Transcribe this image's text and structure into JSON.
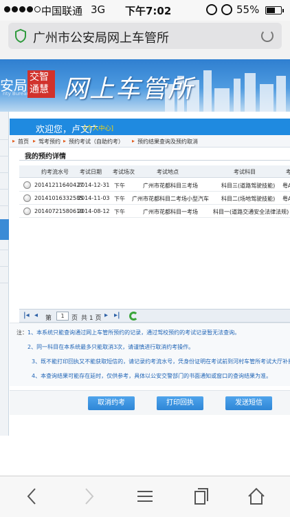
{
  "status": {
    "carrier": "中国联通",
    "network": "3G",
    "time": "下午7:02",
    "battery": "55%"
  },
  "browser": {
    "title": "广州市公安局网上车管所"
  },
  "banner": {
    "left_text": "安局",
    "left_sub": "rity Bureau",
    "badge_top": "交智",
    "badge_bottom": "通慧",
    "logo": "网上车管所"
  },
  "welcome": {
    "greeting": "欢迎您，卢文广",
    "user_center": "[个人中心]"
  },
  "breadcrumb": [
    "首页",
    "驾考预约",
    "预约考试（自助约考）",
    "预约结果查询及预约取消"
  ],
  "section_title": "我的预约详情",
  "table": {
    "headers": [
      "约考流水号",
      "考试日期",
      "考试场次",
      "考试地点",
      "考试科目",
      "考"
    ],
    "rows": [
      [
        "20141211640427",
        "2014-12-31",
        "下午",
        "广州市花都科目三考场",
        "科目三(道路驾驶技能)",
        "粤A"
      ],
      [
        "20141016332585",
        "2014-11-03",
        "下午",
        "广州市花都科目二考场小型汽车",
        "科目二(场地驾驶技能)",
        "粤A"
      ],
      [
        "20140721580610",
        "2014-08-12",
        "下午",
        "广州市花都科目一考场",
        "科目一(道路交通安全法律法规)",
        ""
      ]
    ]
  },
  "pager": {
    "page_label": "第",
    "page_value": "1",
    "page_unit": "页",
    "total": "共 1 页"
  },
  "notes": {
    "label": "注：",
    "items": [
      "1、本系统只能查询通过网上车管所预约的记录，通过驾校预约的考试记录暂无法查询。",
      "2、同一科目在本系统最多只能取消3次，请谨慎进行取消约考操作。",
      "3、既不能打印回执又不能获取短信的，请记录约考流水号，凭身份证明在考试前到河村车管所考试大厅补打约考",
      "4、本查询结果可能存在延时，仅供参考，具体以公安交警部门的书面通知或窗口的查询结果为准。"
    ]
  },
  "buttons": {
    "cancel": "取消约考",
    "print": "打印回执",
    "sms": "发送短信"
  }
}
